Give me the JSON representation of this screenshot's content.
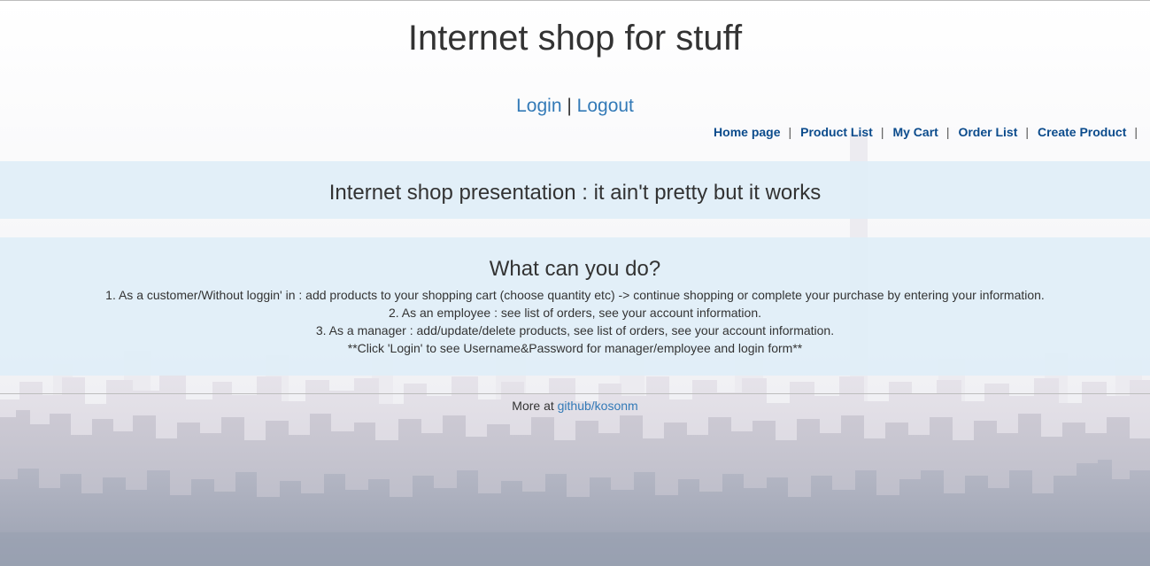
{
  "header": {
    "title": "Internet shop for stuff",
    "login_label": "Login",
    "auth_separator": "|",
    "logout_label": "Logout"
  },
  "menu": {
    "items": [
      {
        "label": "Home page"
      },
      {
        "label": "Product List"
      },
      {
        "label": "My Cart"
      },
      {
        "label": "Order List"
      },
      {
        "label": "Create Product"
      }
    ],
    "separator": "|"
  },
  "presentation": {
    "text": "Internet shop presentation : it ain't pretty but it works"
  },
  "info": {
    "heading": "What can you do?",
    "lines": [
      "1. As a customer/Without loggin' in : add products to your shopping cart (choose quantity etc) -> continue shopping or complete your purchase by entering your information.",
      "2. As an employee : see list of orders, see your account information.",
      "3. As a manager : add/update/delete products, see list of orders, see your account information.",
      "**Click 'Login' to see Username&Password for manager/employee and login form**"
    ]
  },
  "footer": {
    "prefix": "More at",
    "link_label": "github/kosonm"
  },
  "colors": {
    "link": "#337ab7",
    "menu_link": "#0b4b8c",
    "panel_background": "#e0eef7"
  }
}
